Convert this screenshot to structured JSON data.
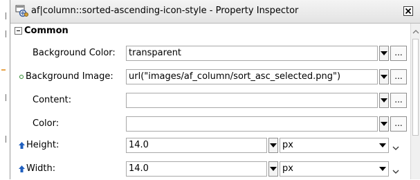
{
  "window": {
    "title": "af|column::sorted-ascending-icon-style - Property Inspector"
  },
  "section": {
    "title": "Common"
  },
  "properties": [
    {
      "label": "Background Color:",
      "value": "transparent",
      "indicator": ""
    },
    {
      "label": "Background Image:",
      "value": "url(\"images/af_column/sort_asc_selected.png\")",
      "indicator": "dot"
    },
    {
      "label": "Content:",
      "value": "",
      "indicator": ""
    },
    {
      "label": "Color:",
      "value": "",
      "indicator": ""
    },
    {
      "label": "Height:",
      "value": "14.0",
      "unit": "px",
      "indicator": "arrow"
    },
    {
      "label": "Width:",
      "value": "14.0",
      "unit": "px",
      "indicator": "arrow"
    }
  ],
  "buttons": {
    "ellipsis": "..."
  },
  "colors": {
    "indicator_dot": "#2e8b2e",
    "indicator_arrow": "#1f5fbf"
  }
}
